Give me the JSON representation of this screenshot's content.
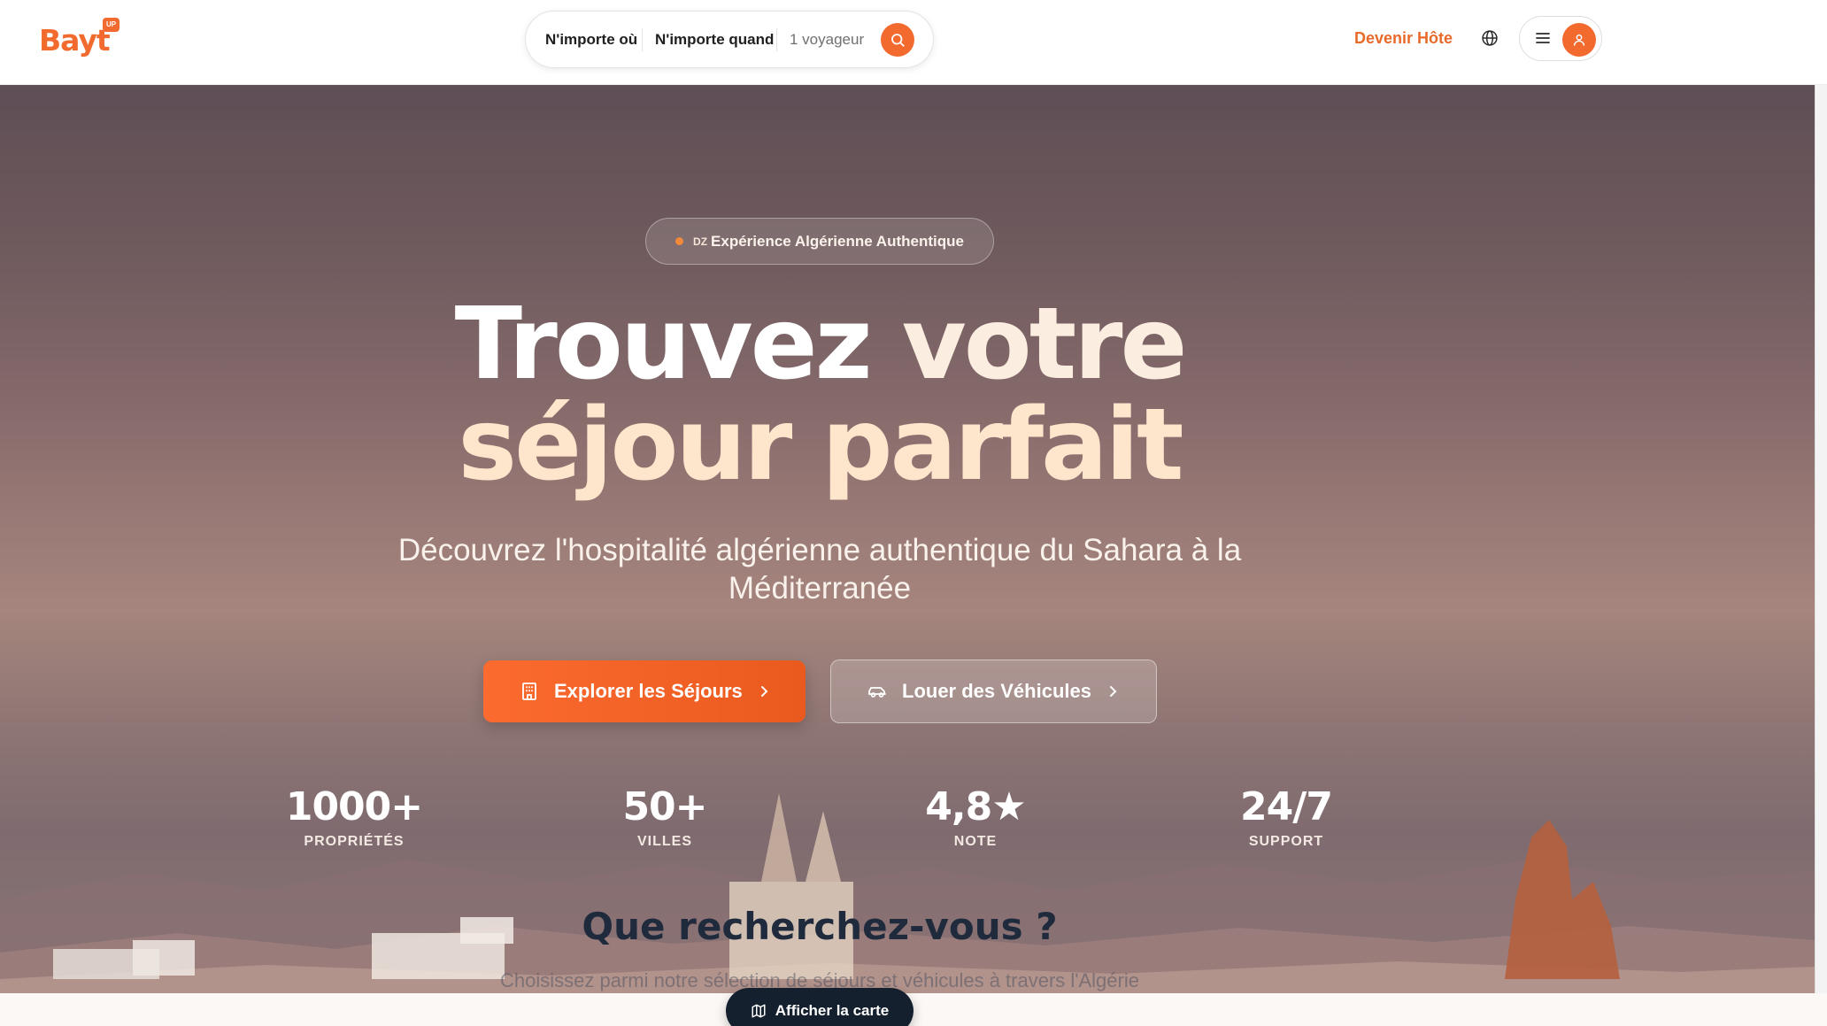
{
  "brand": {
    "name": "Bayt",
    "badge": "UP",
    "accent": "#f26a2e"
  },
  "search": {
    "where": "N'importe où",
    "when": "N'importe quand",
    "guests": "1 voyageur"
  },
  "nav": {
    "host_link": "Devenir Hôte"
  },
  "hero": {
    "pill_flag": "DZ",
    "pill_text": "Expérience Algérienne Authentique",
    "title_part1": "Trouvez",
    "title_part2": "votre",
    "title_line2": "séjour parfait",
    "subtitle": "Découvrez l'hospitalité algérienne authentique du Sahara à la Méditerranée",
    "btn_explore": "Explorer les Séjours",
    "btn_vehicles": "Louer des Véhicules"
  },
  "stats": [
    {
      "value": "1000+",
      "label": "PROPRIÉTÉS"
    },
    {
      "value": "50+",
      "label": "VILLES"
    },
    {
      "value": "4,8★",
      "label": "NOTE"
    },
    {
      "value": "24/7",
      "label": "SUPPORT"
    }
  ],
  "section": {
    "title": "Que recherchez-vous ?",
    "subtitle": "Choisissez parmi notre sélection de séjours et véhicules à travers l'Algérie"
  },
  "map_button": "Afficher la carte",
  "icons": [
    "search-icon",
    "globe-icon",
    "menu-icon",
    "user-icon",
    "building-icon",
    "car-icon",
    "chevron-right-icon",
    "map-icon"
  ]
}
